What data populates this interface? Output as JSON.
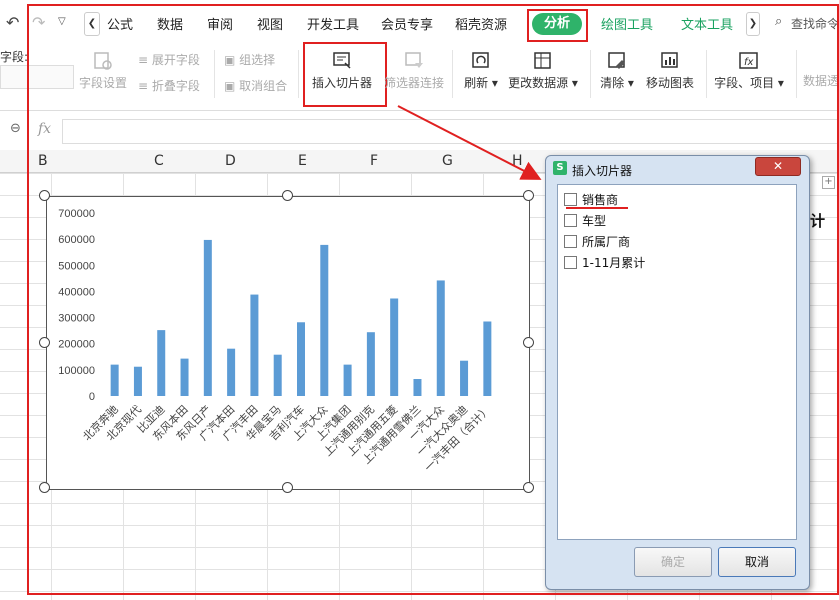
{
  "tabs": {
    "items": [
      "公式",
      "数据",
      "审阅",
      "视图",
      "开发工具",
      "会员专享",
      "稻壳资源"
    ],
    "analyze": "分析",
    "chart_tools": "绘图工具",
    "text_tools": "文本工具",
    "search": "查找命令"
  },
  "ribbon": {
    "field_label": "字段:",
    "field_settings": "字段设置",
    "expand_field": "展开字段",
    "collapse_field": "折叠字段",
    "group_selection": "组选择",
    "ungroup": "取消组合",
    "insert_slicer": "插入切片器",
    "filter_connections": "筛选器连接",
    "refresh": "刷新",
    "change_source": "更改数据源",
    "clear": "清除",
    "move_chart": "移动图表",
    "fields_items": "字段、项目",
    "data_perspective": "数据透"
  },
  "formula_bar": {
    "fx": "fx"
  },
  "columns": [
    "B",
    "C",
    "D",
    "E",
    "F",
    "G",
    "H"
  ],
  "sheet_partial_text": "计",
  "chart_data": {
    "type": "bar",
    "categories": [
      "北京奔驰",
      "北京现代",
      "比亚迪",
      "东风本田",
      "东风日产",
      "广汽本田",
      "广汽丰田",
      "华晨宝马",
      "吉利汽车",
      "上汽大众",
      "上汽集团",
      "上汽通用别克",
      "上汽通用五菱",
      "上汽通用雪佛兰",
      "一汽大众",
      "一汽大众奥迪",
      "一汽丰田（合计）"
    ],
    "values": [
      120000,
      112000,
      252000,
      143000,
      597000,
      181000,
      388000,
      158000,
      282000,
      578000,
      120000,
      244000,
      373000,
      65000,
      442000,
      135000,
      285000
    ],
    "ylim": [
      0,
      700000
    ],
    "yticks": [
      "700000",
      "600000",
      "500000",
      "400000",
      "300000",
      "200000",
      "100000",
      "0"
    ],
    "color": "#5b9bd5"
  },
  "dialog": {
    "title": "插入切片器",
    "options": [
      "销售商",
      "车型",
      "所属厂商",
      "1-11月累计"
    ],
    "ok": "确定",
    "cancel": "取消"
  },
  "colors": {
    "highlight": "#e02020",
    "accent": "#2fb36a"
  }
}
